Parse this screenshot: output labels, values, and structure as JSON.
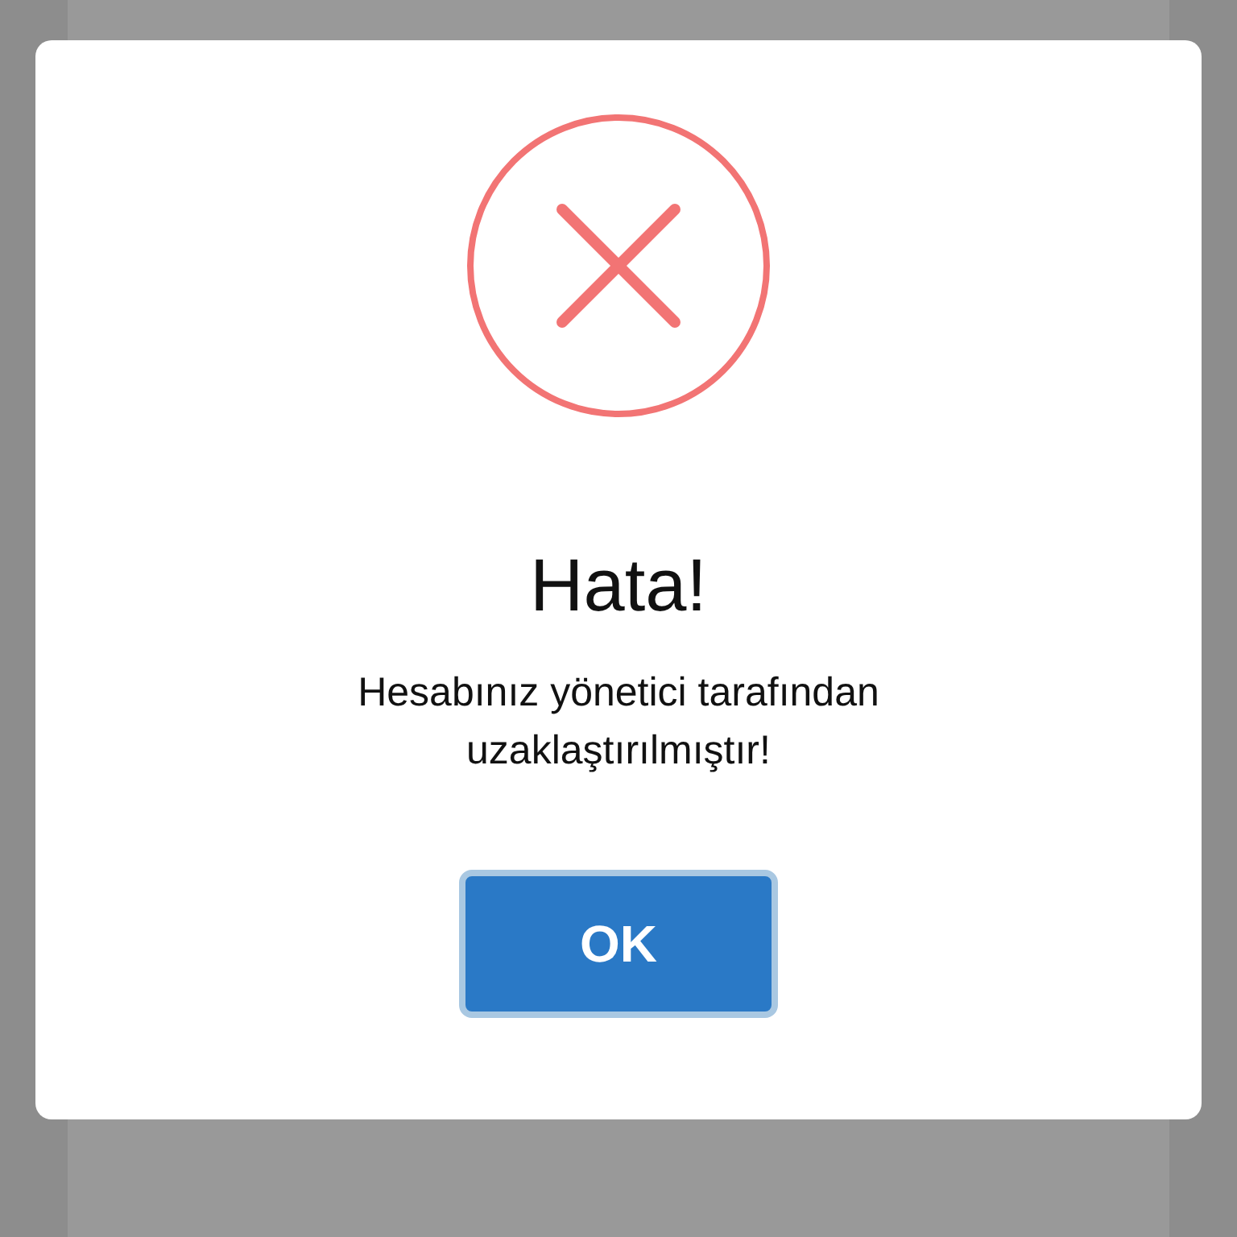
{
  "dialog": {
    "kind": "error",
    "title": "Hata!",
    "message": "Hesabınız yönetici tarafından",
    "message_line2": "uzaklaştırılmıştır!",
    "button": "OK"
  }
}
